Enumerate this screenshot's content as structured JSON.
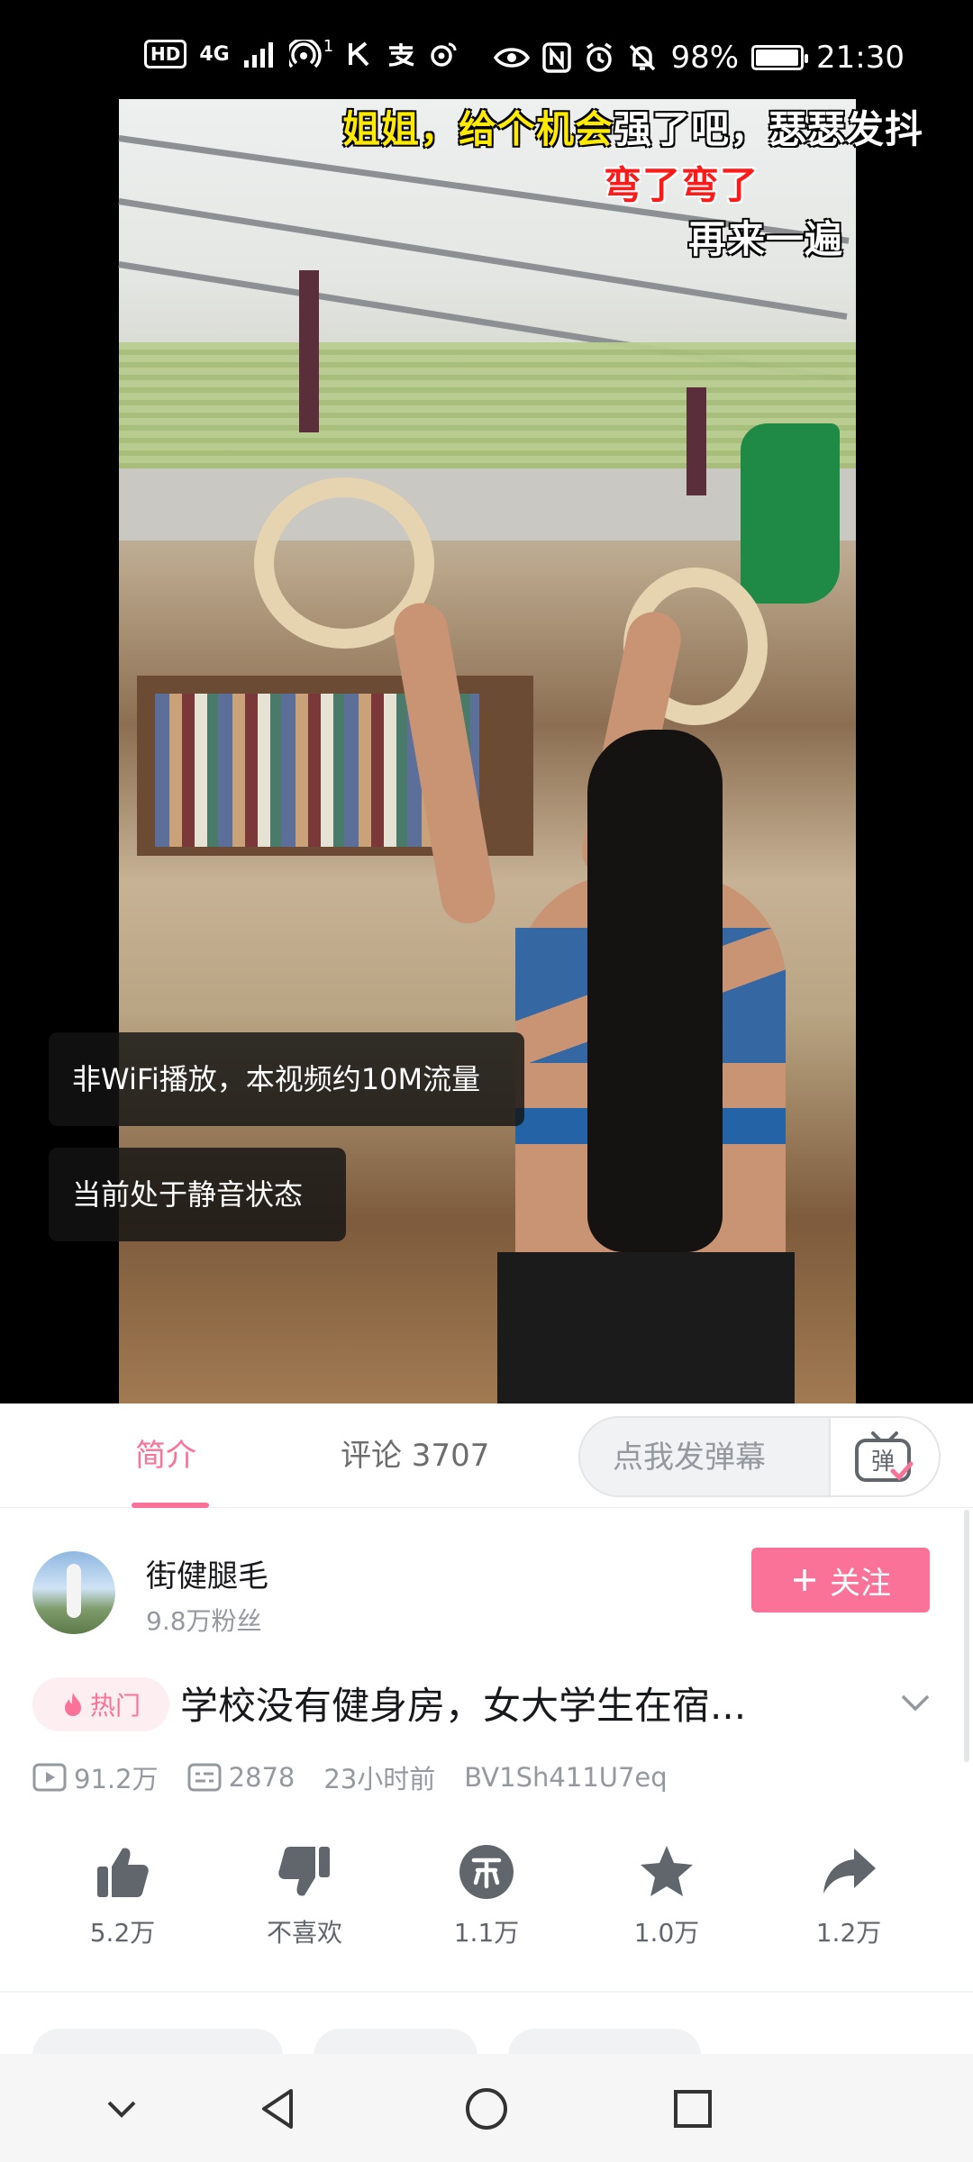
{
  "status_bar": {
    "hd": "HD",
    "network": "4G",
    "hotspot_sup": "1",
    "battery": "98%",
    "battery_level": 0.98,
    "time": "21:30"
  },
  "video": {
    "danmaku": [
      {
        "highlight": "姐姐，给个机会",
        "rest": "强了吧，瑟瑟发抖"
      },
      {
        "text": "弯了弯了"
      },
      {
        "text": "再来一遍"
      }
    ],
    "toasts": [
      "非WiFi播放，本视频约10M流量",
      "当前处于静音状态"
    ]
  },
  "tabs": {
    "intro": "简介",
    "comments": "评论 3707",
    "danmaku_placeholder": "点我发弹幕",
    "danmaku_switch_glyph": "弹"
  },
  "uploader": {
    "name": "街健腿毛",
    "fans": "9.8万粉丝",
    "follow_label": "关注"
  },
  "video_info": {
    "hot_label": "热门",
    "title": "学校没有健身房，女大学生在宿...",
    "views": "91.2万",
    "danmaku_count": "2878",
    "time_ago": "23小时前",
    "bvid": "BV1Sh411U7eq"
  },
  "actions": [
    {
      "name": "like",
      "label": "5.2万"
    },
    {
      "name": "dislike",
      "label": "不喜欢"
    },
    {
      "name": "coin",
      "label": "1.1万"
    },
    {
      "name": "favorite",
      "label": "1.0万"
    },
    {
      "name": "share",
      "label": "1.2万"
    }
  ],
  "colors": {
    "accent": "#fb7299",
    "text_primary": "#18191c",
    "text_secondary": "#9499a0"
  },
  "icons": {
    "nav": [
      "chevron-down-icon",
      "back-triangle-icon",
      "home-circle-icon",
      "recents-square-icon"
    ]
  }
}
